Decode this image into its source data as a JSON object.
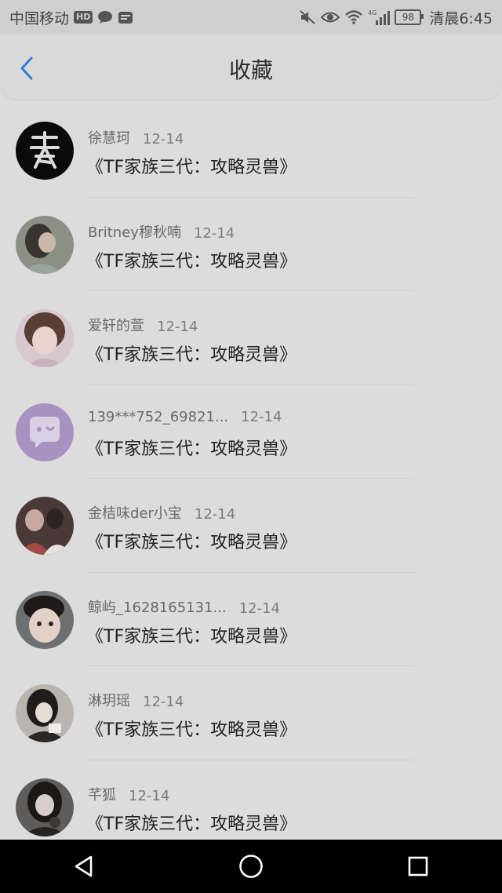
{
  "status_bar": {
    "carrier": "中国移动",
    "hd_badge": "HD",
    "network": "4G",
    "battery": "98",
    "time": "清晨6:45",
    "icons": [
      "hd-icon",
      "message-icon",
      "app-notification-icon",
      "mute-icon",
      "eye-icon",
      "wifi-icon",
      "signal-icon",
      "battery-icon"
    ]
  },
  "header": {
    "title": "收藏",
    "back_icon": "chevron-left-icon",
    "accent_color": "#2f7fd0"
  },
  "favorites": [
    {
      "name": "徐慧珂",
      "date": "12-14",
      "work": "《TF家族三代：攻略灵兽》",
      "avatar_icon": "avatar-calligraphy-logo"
    },
    {
      "name": "Britney穆秋喃",
      "date": "12-14",
      "work": "《TF家族三代：攻略灵兽》",
      "avatar_icon": "avatar-photo"
    },
    {
      "name": "爱轩的萱",
      "date": "12-14",
      "work": "《TF家族三代：攻略灵兽》",
      "avatar_icon": "avatar-photo"
    },
    {
      "name": "139***752_69821...",
      "date": "12-14",
      "work": "《TF家族三代：攻略灵兽》",
      "avatar_icon": "default-chat-avatar-icon"
    },
    {
      "name": "金桔味der小宝",
      "date": "12-14",
      "work": "《TF家族三代：攻略灵兽》",
      "avatar_icon": "avatar-photo"
    },
    {
      "name": "鲸屿_1628165131...",
      "date": "12-14",
      "work": "《TF家族三代：攻略灵兽》",
      "avatar_icon": "avatar-photo"
    },
    {
      "name": "淋玥瑶",
      "date": "12-14",
      "work": "《TF家族三代：攻略灵兽》",
      "avatar_icon": "avatar-photo"
    },
    {
      "name": "芊狐",
      "date": "12-14",
      "work": "《TF家族三代：攻略灵兽》",
      "avatar_icon": "avatar-photo"
    }
  ],
  "nav_bar": {
    "icons": [
      "back-triangle-icon",
      "home-circle-icon",
      "recents-square-icon"
    ]
  }
}
